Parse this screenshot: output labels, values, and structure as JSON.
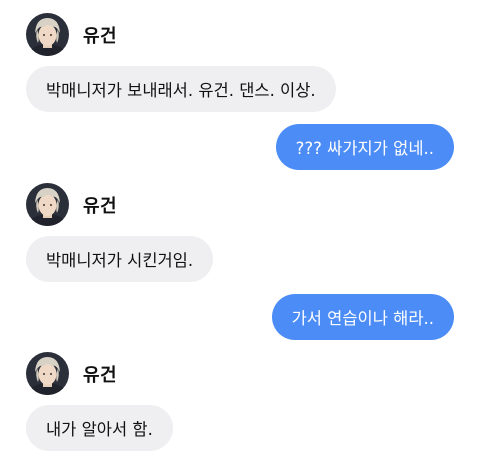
{
  "chat": {
    "contact": {
      "name": "유건",
      "avatar_icon": "avatar-image"
    },
    "messages": [
      {
        "from": "them",
        "text": "박매니저가 보내래서. 유건. 댄스. 이상."
      },
      {
        "from": "me",
        "text": "??? 싸가지가 없네.."
      },
      {
        "from": "them",
        "text": "박매니저가 시킨거임."
      },
      {
        "from": "me",
        "text": "가서 연습이나 해라.."
      },
      {
        "from": "them",
        "text": "내가 알아서 함."
      }
    ]
  },
  "colors": {
    "incoming_bubble": "#efeff1",
    "outgoing_bubble": "#4b8cf7",
    "outgoing_text": "#ffffff"
  }
}
